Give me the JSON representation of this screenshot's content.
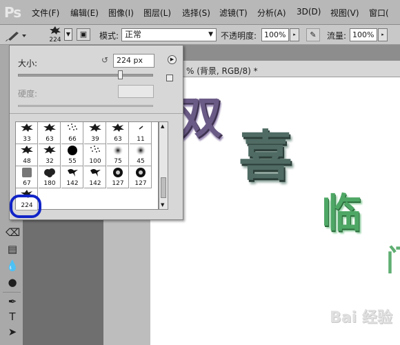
{
  "app": {
    "logo": "Ps"
  },
  "menu": [
    "文件(F)",
    "编辑(E)",
    "图像(I)",
    "图层(L)",
    "选择(S)",
    "滤镜(T)",
    "分析(A)",
    "3D(D)",
    "视图(V)",
    "窗口("
  ],
  "options": {
    "brush_size": "224",
    "picker_arrow_icon": "▼",
    "mode_label": "模式:",
    "mode_value": "正常",
    "mode_arrow_icon": "▼",
    "opacity_label": "不透明度:",
    "opacity_value": "100%",
    "flow_label": "流量:",
    "flow_value": "100%",
    "arrow_icon": "▸"
  },
  "document": {
    "tab_title": "% (背景, RGB/8) *"
  },
  "canvas": {
    "glyph_1": "双",
    "glyph_2": "喜",
    "glyph_3": "临",
    "glyph_4": "门",
    "watermark": "Bai 经验"
  },
  "brush_picker": {
    "size_label": "大小:",
    "size_value": "224 px",
    "hardness_label": "硬度:",
    "menu_icon": "▶",
    "presets": [
      {
        "count": "33",
        "icon": "splatter"
      },
      {
        "count": "63",
        "icon": "splatter"
      },
      {
        "count": "66",
        "icon": "scatter"
      },
      {
        "count": "39",
        "icon": "splatter"
      },
      {
        "count": "63",
        "icon": "splatter"
      },
      {
        "count": "11",
        "icon": "dash"
      },
      {
        "count": "48",
        "icon": "splatter"
      },
      {
        "count": "32",
        "icon": "splatter"
      },
      {
        "count": "55",
        "icon": "hard-round"
      },
      {
        "count": "100",
        "icon": "scatter"
      },
      {
        "count": "75",
        "icon": "soft-round"
      },
      {
        "count": "45",
        "icon": "soft-round"
      },
      {
        "count": "67",
        "icon": "cylinder"
      },
      {
        "count": "180",
        "icon": "cloud"
      },
      {
        "count": "142",
        "icon": "bird"
      },
      {
        "count": "142",
        "icon": "bird"
      },
      {
        "count": "127",
        "icon": "ring"
      },
      {
        "count": "127",
        "icon": "ring"
      },
      {
        "count": "224",
        "icon": "splatter"
      }
    ]
  }
}
